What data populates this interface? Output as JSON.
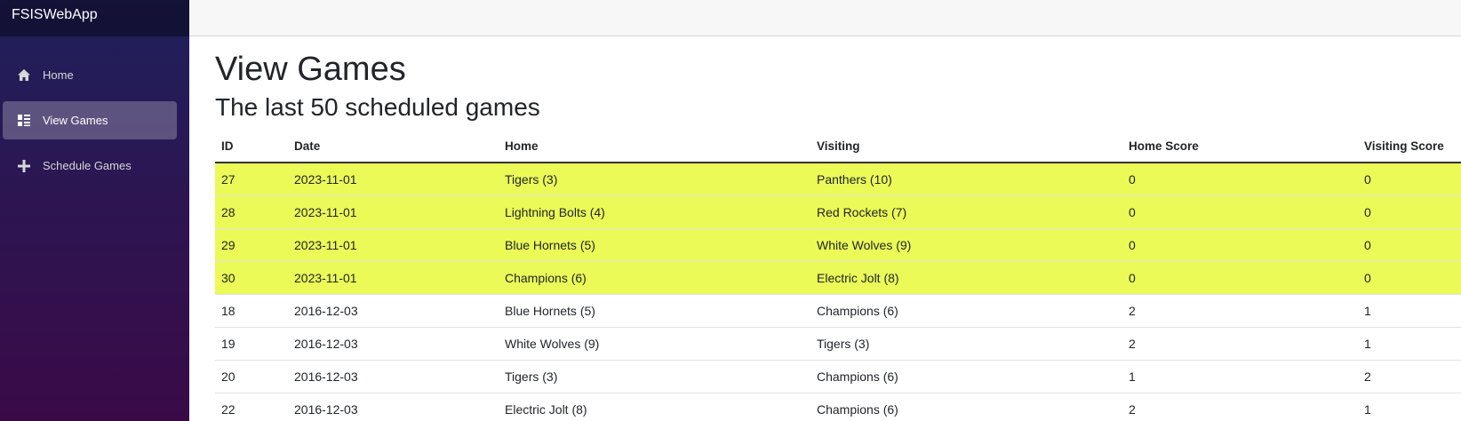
{
  "app": {
    "title": "FSISWebApp"
  },
  "sidebar": {
    "items": [
      {
        "label": "Home",
        "icon": "home-icon",
        "active": false
      },
      {
        "label": "View Games",
        "icon": "list-icon",
        "active": true
      },
      {
        "label": "Schedule Games",
        "icon": "plus-icon",
        "active": false
      }
    ]
  },
  "page": {
    "title": "View Games",
    "subtitle": "The last 50 scheduled games"
  },
  "table": {
    "headers": [
      "ID",
      "Date",
      "Home",
      "Visiting",
      "Home Score",
      "Visiting Score"
    ],
    "rows": [
      {
        "cells": [
          "27",
          "2023-11-01",
          "Tigers (3)",
          "Panthers (10)",
          "0",
          "0"
        ],
        "highlighted": true
      },
      {
        "cells": [
          "28",
          "2023-11-01",
          "Lightning Bolts (4)",
          "Red Rockets (7)",
          "0",
          "0"
        ],
        "highlighted": true
      },
      {
        "cells": [
          "29",
          "2023-11-01",
          "Blue Hornets (5)",
          "White Wolves (9)",
          "0",
          "0"
        ],
        "highlighted": true
      },
      {
        "cells": [
          "30",
          "2023-11-01",
          "Champions (6)",
          "Electric Jolt (8)",
          "0",
          "0"
        ],
        "highlighted": true
      },
      {
        "cells": [
          "18",
          "2016-12-03",
          "Blue Hornets (5)",
          "Champions (6)",
          "2",
          "1"
        ],
        "highlighted": false
      },
      {
        "cells": [
          "19",
          "2016-12-03",
          "White Wolves (9)",
          "Tigers (3)",
          "2",
          "1"
        ],
        "highlighted": false
      },
      {
        "cells": [
          "20",
          "2016-12-03",
          "Tigers (3)",
          "Champions (6)",
          "1",
          "2"
        ],
        "highlighted": false
      },
      {
        "cells": [
          "22",
          "2016-12-03",
          "Electric Jolt (8)",
          "Champions (6)",
          "2",
          "1"
        ],
        "highlighted": false
      }
    ]
  },
  "colors": {
    "highlight": "#ebfa57",
    "sidebar_top": "#1f205b",
    "sidebar_bottom": "#3a0a47"
  }
}
